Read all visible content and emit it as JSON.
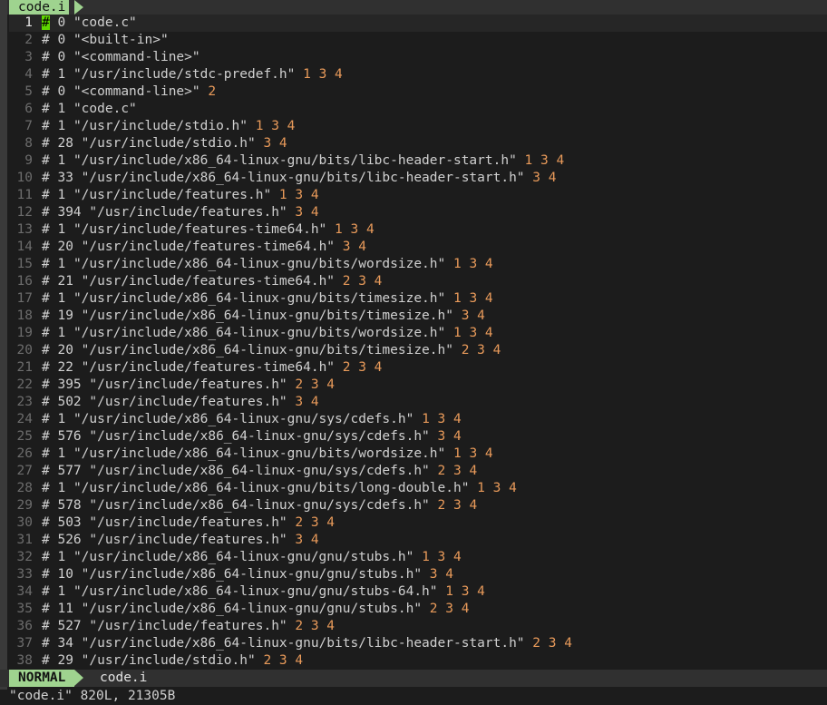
{
  "tab": {
    "label": "code.i"
  },
  "lines": [
    {
      "n": "1",
      "num": "0",
      "path": "\"code.c\"",
      "flags": ""
    },
    {
      "n": "2",
      "num": "0",
      "path": "\"<built-in>\"",
      "flags": ""
    },
    {
      "n": "3",
      "num": "0",
      "path": "\"<command-line>\"",
      "flags": ""
    },
    {
      "n": "4",
      "num": "1",
      "path": "\"/usr/include/stdc-predef.h\"",
      "flags": "1 3 4"
    },
    {
      "n": "5",
      "num": "0",
      "path": "\"<command-line>\"",
      "flags": "2"
    },
    {
      "n": "6",
      "num": "1",
      "path": "\"code.c\"",
      "flags": ""
    },
    {
      "n": "7",
      "num": "1",
      "path": "\"/usr/include/stdio.h\"",
      "flags": "1 3 4"
    },
    {
      "n": "8",
      "num": "28",
      "path": "\"/usr/include/stdio.h\"",
      "flags": "3 4"
    },
    {
      "n": "9",
      "num": "1",
      "path": "\"/usr/include/x86_64-linux-gnu/bits/libc-header-start.h\"",
      "flags": "1 3 4"
    },
    {
      "n": "10",
      "num": "33",
      "path": "\"/usr/include/x86_64-linux-gnu/bits/libc-header-start.h\"",
      "flags": "3 4"
    },
    {
      "n": "11",
      "num": "1",
      "path": "\"/usr/include/features.h\"",
      "flags": "1 3 4"
    },
    {
      "n": "12",
      "num": "394",
      "path": "\"/usr/include/features.h\"",
      "flags": "3 4"
    },
    {
      "n": "13",
      "num": "1",
      "path": "\"/usr/include/features-time64.h\"",
      "flags": "1 3 4"
    },
    {
      "n": "14",
      "num": "20",
      "path": "\"/usr/include/features-time64.h\"",
      "flags": "3 4"
    },
    {
      "n": "15",
      "num": "1",
      "path": "\"/usr/include/x86_64-linux-gnu/bits/wordsize.h\"",
      "flags": "1 3 4"
    },
    {
      "n": "16",
      "num": "21",
      "path": "\"/usr/include/features-time64.h\"",
      "flags": "2 3 4"
    },
    {
      "n": "17",
      "num": "1",
      "path": "\"/usr/include/x86_64-linux-gnu/bits/timesize.h\"",
      "flags": "1 3 4"
    },
    {
      "n": "18",
      "num": "19",
      "path": "\"/usr/include/x86_64-linux-gnu/bits/timesize.h\"",
      "flags": "3 4"
    },
    {
      "n": "19",
      "num": "1",
      "path": "\"/usr/include/x86_64-linux-gnu/bits/wordsize.h\"",
      "flags": "1 3 4"
    },
    {
      "n": "20",
      "num": "20",
      "path": "\"/usr/include/x86_64-linux-gnu/bits/timesize.h\"",
      "flags": "2 3 4"
    },
    {
      "n": "21",
      "num": "22",
      "path": "\"/usr/include/features-time64.h\"",
      "flags": "2 3 4"
    },
    {
      "n": "22",
      "num": "395",
      "path": "\"/usr/include/features.h\"",
      "flags": "2 3 4"
    },
    {
      "n": "23",
      "num": "502",
      "path": "\"/usr/include/features.h\"",
      "flags": "3 4"
    },
    {
      "n": "24",
      "num": "1",
      "path": "\"/usr/include/x86_64-linux-gnu/sys/cdefs.h\"",
      "flags": "1 3 4"
    },
    {
      "n": "25",
      "num": "576",
      "path": "\"/usr/include/x86_64-linux-gnu/sys/cdefs.h\"",
      "flags": "3 4"
    },
    {
      "n": "26",
      "num": "1",
      "path": "\"/usr/include/x86_64-linux-gnu/bits/wordsize.h\"",
      "flags": "1 3 4"
    },
    {
      "n": "27",
      "num": "577",
      "path": "\"/usr/include/x86_64-linux-gnu/sys/cdefs.h\"",
      "flags": "2 3 4"
    },
    {
      "n": "28",
      "num": "1",
      "path": "\"/usr/include/x86_64-linux-gnu/bits/long-double.h\"",
      "flags": "1 3 4"
    },
    {
      "n": "29",
      "num": "578",
      "path": "\"/usr/include/x86_64-linux-gnu/sys/cdefs.h\"",
      "flags": "2 3 4"
    },
    {
      "n": "30",
      "num": "503",
      "path": "\"/usr/include/features.h\"",
      "flags": "2 3 4"
    },
    {
      "n": "31",
      "num": "526",
      "path": "\"/usr/include/features.h\"",
      "flags": "3 4"
    },
    {
      "n": "32",
      "num": "1",
      "path": "\"/usr/include/x86_64-linux-gnu/gnu/stubs.h\"",
      "flags": "1 3 4"
    },
    {
      "n": "33",
      "num": "10",
      "path": "\"/usr/include/x86_64-linux-gnu/gnu/stubs.h\"",
      "flags": "3 4"
    },
    {
      "n": "34",
      "num": "1",
      "path": "\"/usr/include/x86_64-linux-gnu/gnu/stubs-64.h\"",
      "flags": "1 3 4"
    },
    {
      "n": "35",
      "num": "11",
      "path": "\"/usr/include/x86_64-linux-gnu/gnu/stubs.h\"",
      "flags": "2 3 4"
    },
    {
      "n": "36",
      "num": "527",
      "path": "\"/usr/include/features.h\"",
      "flags": "2 3 4"
    },
    {
      "n": "37",
      "num": "34",
      "path": "\"/usr/include/x86_64-linux-gnu/bits/libc-header-start.h\"",
      "flags": "2 3 4"
    },
    {
      "n": "38",
      "num": "29",
      "path": "\"/usr/include/stdio.h\"",
      "flags": "2 3 4"
    }
  ],
  "status": {
    "mode": "NORMAL",
    "file": "code.i"
  },
  "cmdline": {
    "text": "\"code.i\" 820L, 21305B"
  },
  "colors": {
    "accent": "#9fd38f",
    "cursor": "#5fd700",
    "flags": "#e89a5a"
  }
}
